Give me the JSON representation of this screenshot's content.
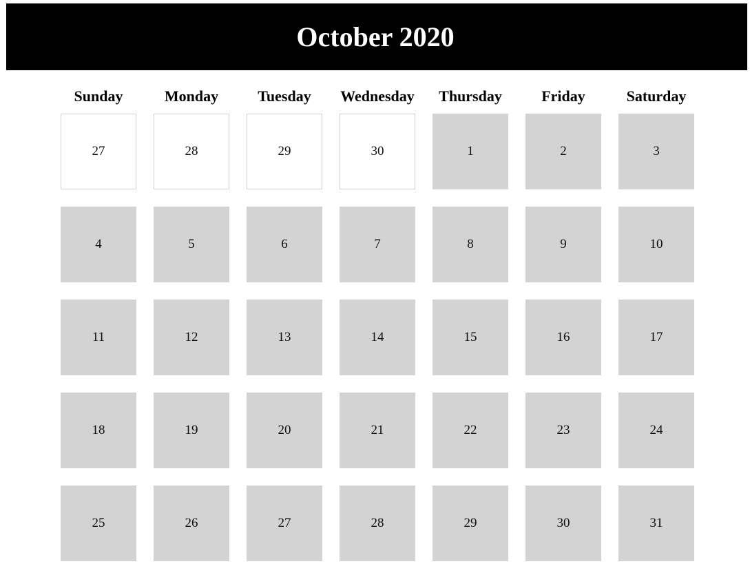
{
  "calendar": {
    "title": "October 2020",
    "weekdays": [
      "Sunday",
      "Monday",
      "Tuesday",
      "Wednesday",
      "Thursday",
      "Friday",
      "Saturday"
    ],
    "colors": {
      "header_bg": "#000000",
      "header_text": "#ffffff",
      "current_month_cell": "#d3d3d3",
      "other_month_cell": "#ffffff",
      "other_month_border": "#cfcfcf"
    },
    "days": [
      {
        "label": "27",
        "in_month": false
      },
      {
        "label": "28",
        "in_month": false
      },
      {
        "label": "29",
        "in_month": false
      },
      {
        "label": "30",
        "in_month": false
      },
      {
        "label": "1",
        "in_month": true
      },
      {
        "label": "2",
        "in_month": true
      },
      {
        "label": "3",
        "in_month": true
      },
      {
        "label": "4",
        "in_month": true
      },
      {
        "label": "5",
        "in_month": true
      },
      {
        "label": "6",
        "in_month": true
      },
      {
        "label": "7",
        "in_month": true
      },
      {
        "label": "8",
        "in_month": true
      },
      {
        "label": "9",
        "in_month": true
      },
      {
        "label": "10",
        "in_month": true
      },
      {
        "label": "11",
        "in_month": true
      },
      {
        "label": "12",
        "in_month": true
      },
      {
        "label": "13",
        "in_month": true
      },
      {
        "label": "14",
        "in_month": true
      },
      {
        "label": "15",
        "in_month": true
      },
      {
        "label": "16",
        "in_month": true
      },
      {
        "label": "17",
        "in_month": true
      },
      {
        "label": "18",
        "in_month": true
      },
      {
        "label": "19",
        "in_month": true
      },
      {
        "label": "20",
        "in_month": true
      },
      {
        "label": "21",
        "in_month": true
      },
      {
        "label": "22",
        "in_month": true
      },
      {
        "label": "23",
        "in_month": true
      },
      {
        "label": "24",
        "in_month": true
      },
      {
        "label": "25",
        "in_month": true
      },
      {
        "label": "26",
        "in_month": true
      },
      {
        "label": "27",
        "in_month": true
      },
      {
        "label": "28",
        "in_month": true
      },
      {
        "label": "29",
        "in_month": true
      },
      {
        "label": "30",
        "in_month": true
      },
      {
        "label": "31",
        "in_month": true
      }
    ]
  }
}
